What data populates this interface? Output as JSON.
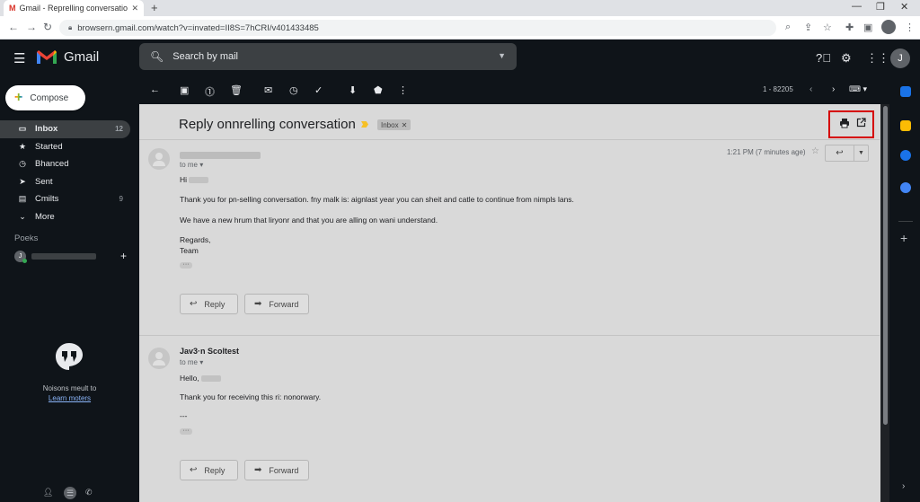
{
  "browser": {
    "tab_title": "Gmail - Reprelling conversation",
    "tab_logo": "M",
    "url": "browsern.gmail.com/watch?v=invated=II8S=7hCRI/v401433485"
  },
  "header": {
    "app_name": "Gmail",
    "search_placeholder": "Search by mail",
    "avatar_letter": "J"
  },
  "sidebar": {
    "compose_label": "Compose",
    "items": [
      {
        "label": "Inbox",
        "count": "12",
        "icon": "inbox-icon"
      },
      {
        "label": "Started",
        "count": "",
        "icon": "star-icon"
      },
      {
        "label": "Bhanced",
        "count": "",
        "icon": "clock-icon"
      },
      {
        "label": "Sent",
        "count": "",
        "icon": "send-icon"
      },
      {
        "label": "Cmilts",
        "count": "9",
        "icon": "file-icon"
      },
      {
        "label": "More",
        "count": "",
        "icon": "chevron-down-icon"
      }
    ],
    "people_section": "Poeks",
    "person_initial": "J",
    "hangouts_text": "Noisons meult to",
    "hangouts_link": "Learn moters"
  },
  "toolbar": {
    "paging": "1 - 82205"
  },
  "thread": {
    "subject": "Reply onnrelling conversation",
    "label_badge": "Inbox",
    "messages": [
      {
        "sender": "",
        "to": "to me",
        "time": "1:21 PM (7 minutes age)",
        "greeting": "Hi",
        "lines": [
          "Thank you for pn-selling conversation. fny malk is: aignlast year you can sheit and catle to continue from nimpls lans.",
          "We have a new hrum that liryonr and that you are alling on wani understand."
        ],
        "signoff": "Regards,",
        "signature": "Team",
        "reply_label": "Reply",
        "forward_label": "Forward"
      },
      {
        "sender": "Jav3·n Scoltest",
        "to": "to me",
        "greeting": "Hello,",
        "lines": [
          "Thank you for receiving this ri: nonorwary."
        ],
        "sep": "---",
        "reply_label": "Reply",
        "forward_label": "Forward"
      }
    ]
  },
  "colors": {
    "dark_bg": "#0f1419",
    "content_bg": "#d9d9d9",
    "highlight_box": "#d50000",
    "link": "#8ab4f8"
  }
}
